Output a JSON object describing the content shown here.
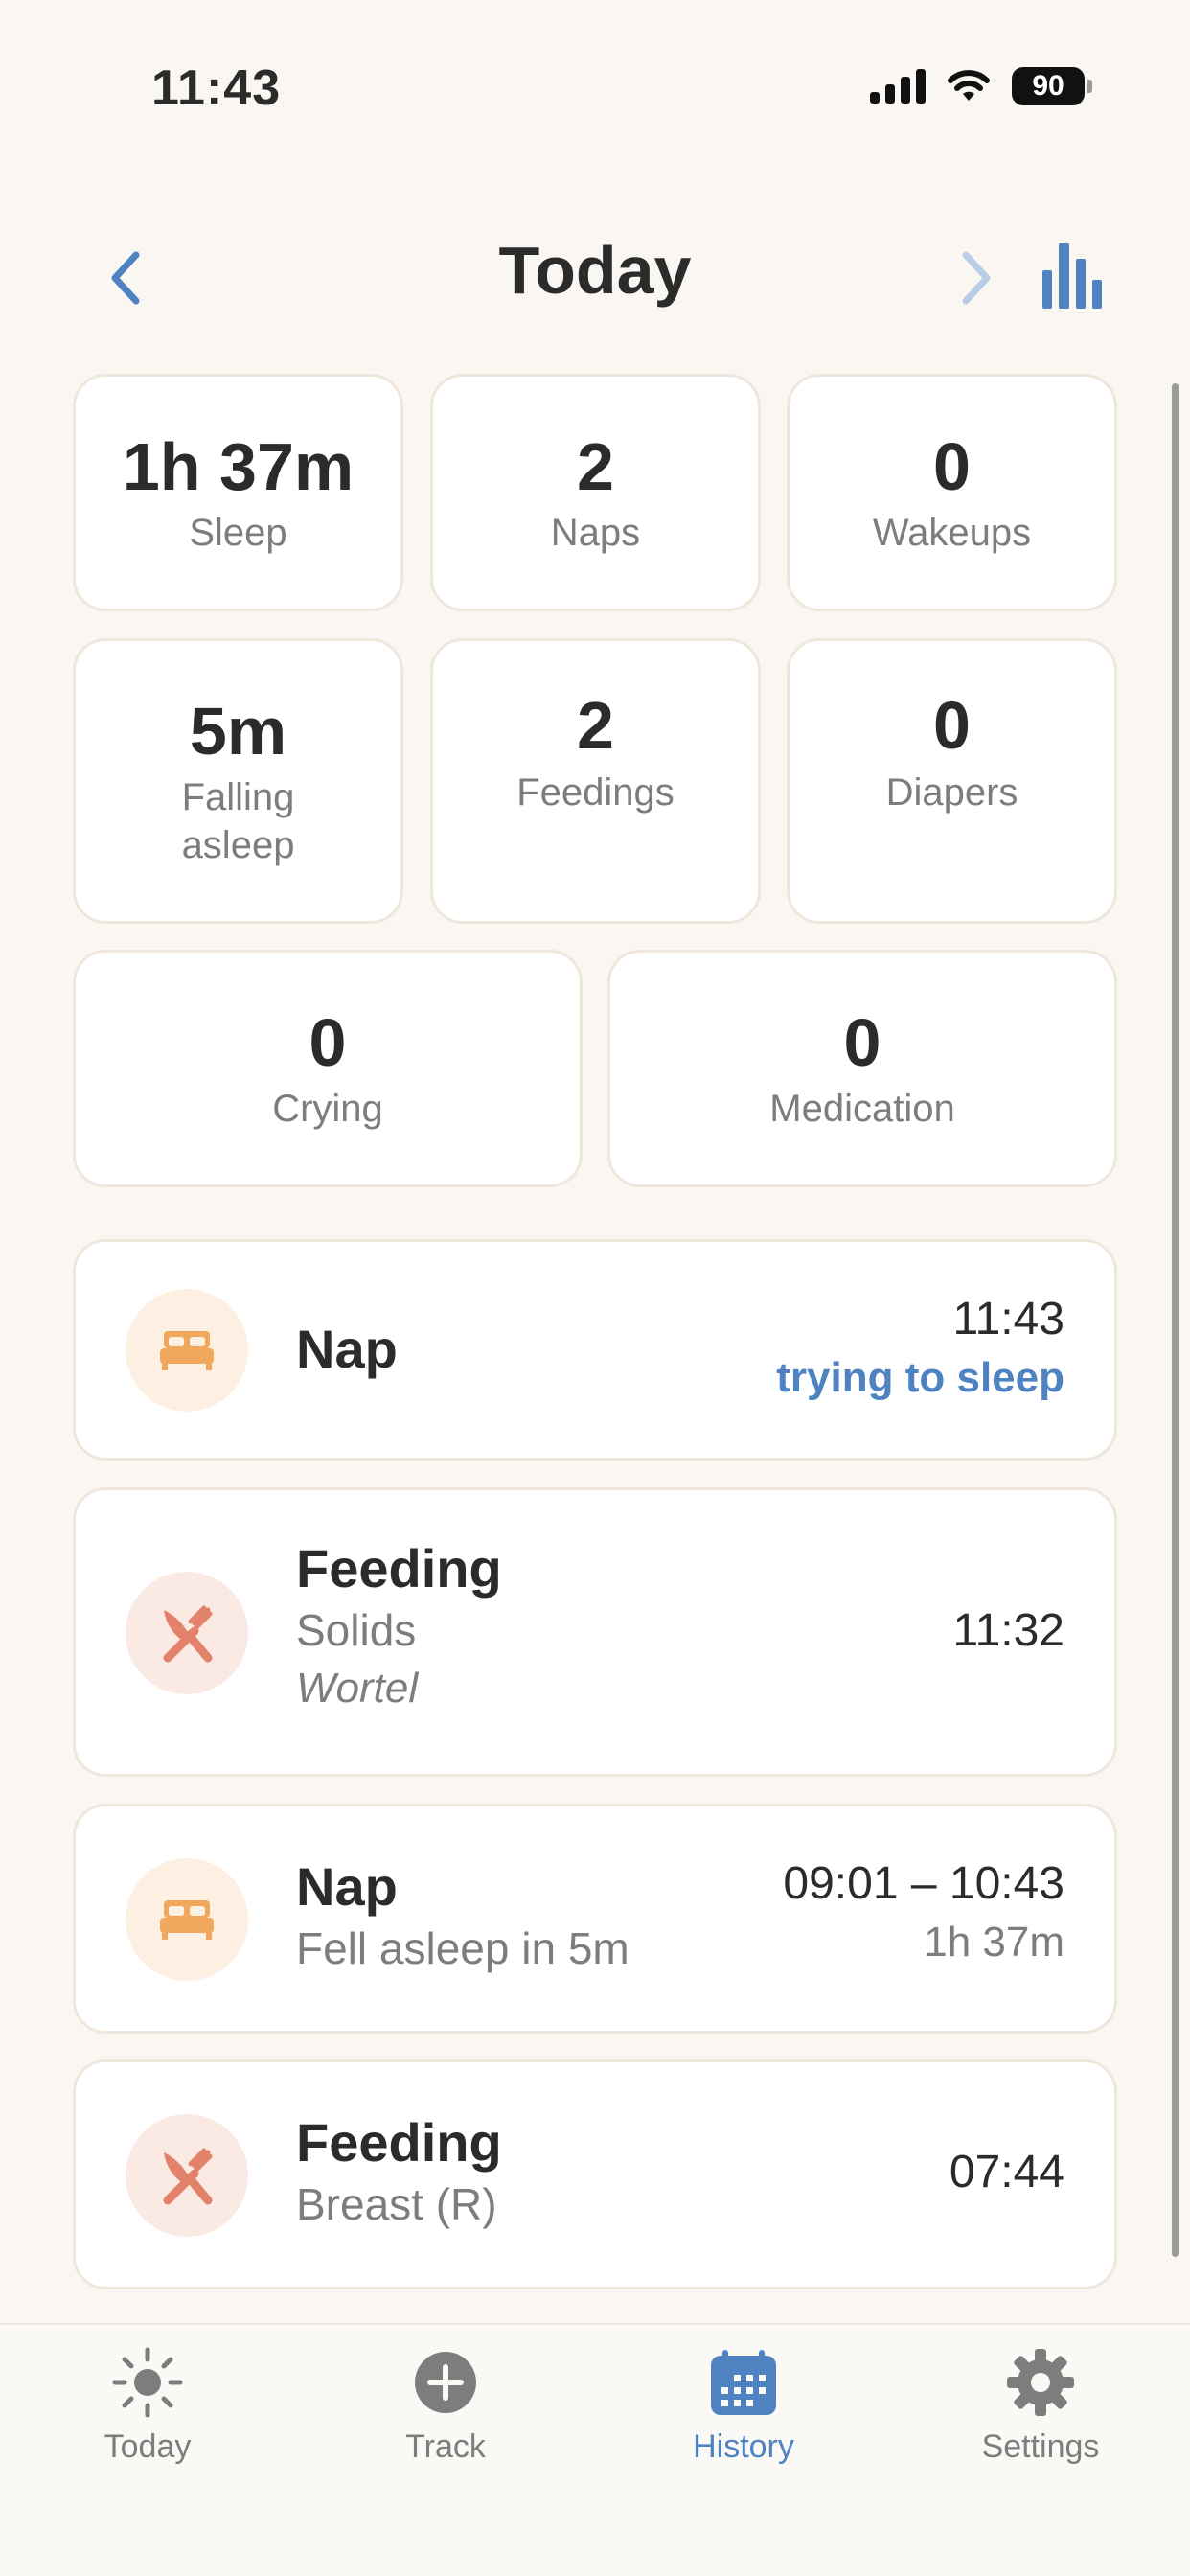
{
  "status_bar": {
    "time": "11:43",
    "battery": "90"
  },
  "header": {
    "title": "Today"
  },
  "stats": [
    {
      "value": "1h 37m",
      "label": "Sleep"
    },
    {
      "value": "2",
      "label": "Naps"
    },
    {
      "value": "0",
      "label": "Wakeups"
    },
    {
      "value": "5m",
      "label": "Falling asleep"
    },
    {
      "value": "2",
      "label": "Feedings"
    },
    {
      "value": "0",
      "label": "Diapers"
    },
    {
      "value": "0",
      "label": "Crying"
    },
    {
      "value": "0",
      "label": "Medication"
    }
  ],
  "events": [
    {
      "type": "nap",
      "icon": "bed-icon",
      "title": "Nap",
      "time": "11:43",
      "status": "trying to sleep"
    },
    {
      "type": "feeding",
      "icon": "fork-knife-icon",
      "title": "Feeding",
      "subtitle": "Solids",
      "note": "Wortel",
      "time": "11:32"
    },
    {
      "type": "nap",
      "icon": "bed-icon",
      "title": "Nap",
      "subtitle": "Fell asleep in 5m",
      "time": "09:01 – 10:43",
      "duration": "1h 37m"
    },
    {
      "type": "feeding",
      "icon": "fork-knife-icon",
      "title": "Feeding",
      "subtitle": "Breast (R)",
      "time": "07:44"
    }
  ],
  "tabs": [
    {
      "label": "Today",
      "icon": "sun-icon",
      "active": false
    },
    {
      "label": "Track",
      "icon": "plus-circle-icon",
      "active": false
    },
    {
      "label": "History",
      "icon": "calendar-icon",
      "active": true
    },
    {
      "label": "Settings",
      "icon": "gear-icon",
      "active": false
    }
  ],
  "colors": {
    "accent": "#4f82c1",
    "nap": "#f2a85c",
    "feeding": "#e3826a",
    "background": "#faf7f2"
  }
}
